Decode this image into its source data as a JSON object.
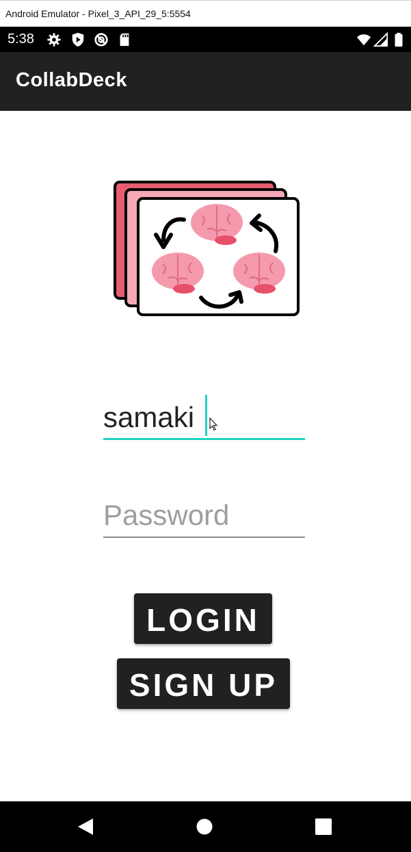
{
  "window": {
    "title": "Android Emulator - Pixel_3_API_29_5:5554"
  },
  "status_bar": {
    "time": "5:38",
    "left_icons": [
      "gear-icon",
      "shield-play-icon",
      "no-sync-icon",
      "sd-card-icon"
    ],
    "right_icons": [
      "wifi-icon",
      "signal-icon",
      "battery-icon"
    ]
  },
  "app_bar": {
    "title": "CollabDeck"
  },
  "logo": {
    "icon": "flashcards-brains-cycle-icon",
    "colors": {
      "card_back": "#e85d70",
      "card_middle": "#f5a8b5",
      "brain": "#f49aac"
    }
  },
  "form": {
    "username": {
      "value": "samaki",
      "focused": true
    },
    "password": {
      "value": "",
      "placeholder": "Password"
    }
  },
  "buttons": {
    "login_label": "LOGIN",
    "signup_label": "SIGN UP"
  },
  "nav_bar": {
    "icons": [
      "back-icon",
      "home-icon",
      "recents-icon"
    ]
  },
  "colors": {
    "accent": "#1ed3c2",
    "app_bar": "#212121",
    "button": "#212121"
  }
}
